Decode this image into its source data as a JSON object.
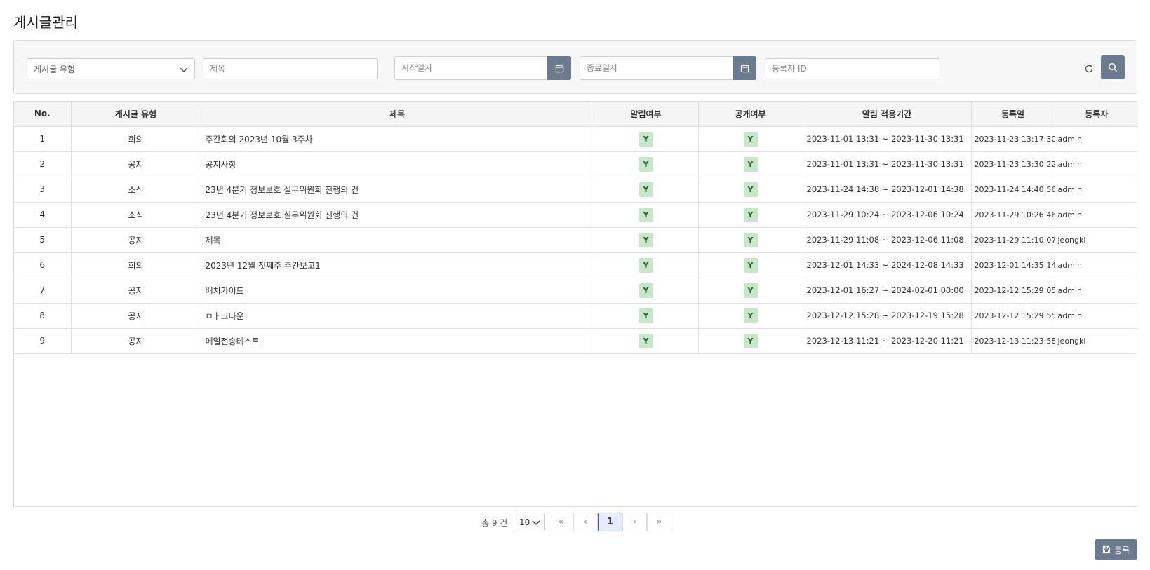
{
  "page": {
    "title": "게시글관리"
  },
  "search": {
    "type_placeholder": "게시글 유형",
    "title_placeholder": "제목",
    "start_placeholder": "시작일자",
    "end_placeholder": "종료일자",
    "author_placeholder": "등록자 ID"
  },
  "table": {
    "headers": {
      "no": "No.",
      "type": "게시글 유형",
      "title": "제목",
      "notify": "알림여부",
      "public": "공개여부",
      "period": "알림 적용기간",
      "reg_date": "등록일",
      "author": "등록자"
    },
    "rows": [
      {
        "no": "1",
        "type": "회의",
        "title": "주간회의 2023년 10월 3주차",
        "notify": "Y",
        "public": "Y",
        "period": "2023-11-01 13:31 ~ 2023-11-30 13:31",
        "reg_date": "2023-11-23 13:17:30",
        "author": "admin"
      },
      {
        "no": "2",
        "type": "공지",
        "title": "공지사항",
        "notify": "Y",
        "public": "Y",
        "period": "2023-11-01 13:31 ~ 2023-11-30 13:31",
        "reg_date": "2023-11-23 13:30:22",
        "author": "admin"
      },
      {
        "no": "3",
        "type": "소식",
        "title": "23년 4분기 정보보호 실무위원회 진행의 건",
        "notify": "Y",
        "public": "Y",
        "period": "2023-11-24 14:38 ~ 2023-12-01 14:38",
        "reg_date": "2023-11-24 14:40:56",
        "author": "admin"
      },
      {
        "no": "4",
        "type": "소식",
        "title": "23년 4분기 정보보호 실무위원회 진행의 건",
        "notify": "Y",
        "public": "Y",
        "period": "2023-11-29 10:24 ~ 2023-12-06 10:24",
        "reg_date": "2023-11-29 10:26:46",
        "author": "admin"
      },
      {
        "no": "5",
        "type": "공지",
        "title": "제목",
        "notify": "Y",
        "public": "Y",
        "period": "2023-11-29 11:08 ~ 2023-12-06 11:08",
        "reg_date": "2023-11-29 11:10:07",
        "author": "jeongki"
      },
      {
        "no": "6",
        "type": "회의",
        "title": "2023년 12월 첫째주 주간보고1",
        "notify": "Y",
        "public": "Y",
        "period": "2023-12-01 14:33 ~ 2024-12-08 14:33",
        "reg_date": "2023-12-01 14:35:14",
        "author": "admin"
      },
      {
        "no": "7",
        "type": "공지",
        "title": "배치가이드",
        "notify": "Y",
        "public": "Y",
        "period": "2023-12-01 16:27 ~ 2024-02-01 00:00",
        "reg_date": "2023-12-12 15:29:05",
        "author": "admin"
      },
      {
        "no": "8",
        "type": "공지",
        "title": "ㅁㅏ크다운",
        "notify": "Y",
        "public": "Y",
        "period": "2023-12-12 15:28 ~ 2023-12-19 15:28",
        "reg_date": "2023-12-12 15:29:55",
        "author": "admin"
      },
      {
        "no": "9",
        "type": "공지",
        "title": "메일전송테스트",
        "notify": "Y",
        "public": "Y",
        "period": "2023-12-13 11:21 ~ 2023-12-20 11:21",
        "reg_date": "2023-12-13 11:23:58",
        "author": "jeongki"
      }
    ]
  },
  "pagination": {
    "total_label": "총 9 건",
    "page_size": "10",
    "first": "«",
    "prev": "‹",
    "current": "1",
    "next": "›",
    "last": "»"
  },
  "actions": {
    "register_label": "등록"
  },
  "colors": {
    "accent": "#6b7a8f",
    "badge_bg": "#c8e6c9",
    "page_active": "#4a55c7"
  },
  "icons": {
    "type_select": "chevron-down-icon",
    "date": "calendar-icon",
    "refresh": "refresh-icon",
    "search": "search-icon",
    "register": "save-icon"
  }
}
